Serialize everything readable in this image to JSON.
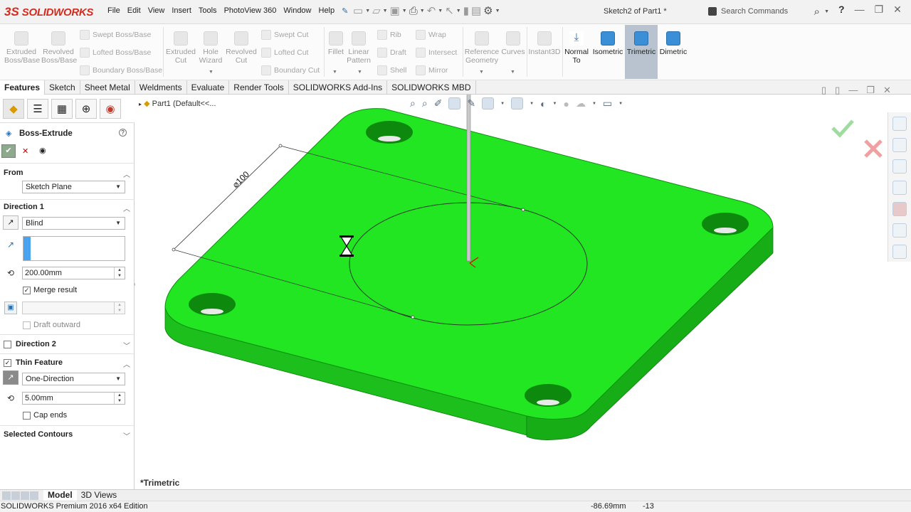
{
  "app": {
    "brand": "SOLIDWORKS",
    "document_title": "Sketch2 of Part1 *"
  },
  "menu": [
    "File",
    "Edit",
    "View",
    "Insert",
    "Tools",
    "PhotoView 360",
    "Window",
    "Help"
  ],
  "search": {
    "placeholder": "Search Commands"
  },
  "help_mark": "?",
  "commands": {
    "extruded_boss": "Extruded\nBoss/Base",
    "revolved_boss": "Revolved\nBoss/Base",
    "swept_boss": "Swept Boss/Base",
    "lofted_boss": "Lofted Boss/Base",
    "boundary_boss": "Boundary Boss/Base",
    "extruded_cut": "Extruded\nCut",
    "hole_wizard": "Hole\nWizard",
    "revolved_cut": "Revolved\nCut",
    "swept_cut": "Swept Cut",
    "lofted_cut": "Lofted Cut",
    "boundary_cut": "Boundary Cut",
    "fillet": "Fillet",
    "linear_pattern": "Linear\nPattern",
    "rib": "Rib",
    "draft": "Draft",
    "shell": "Shell",
    "wrap": "Wrap",
    "intersect": "Intersect",
    "mirror": "Mirror",
    "reference_geometry": "Reference\nGeometry",
    "curves": "Curves",
    "instant3d": "Instant3D",
    "normal_to": "Normal\nTo",
    "isometric": "Isometric",
    "trimetric": "Trimetric",
    "dimetric": "Dimetric"
  },
  "tabs": [
    "Features",
    "Sketch",
    "Sheet Metal",
    "Weldments",
    "Evaluate",
    "Render Tools",
    "SOLIDWORKS Add-Ins",
    "SOLIDWORKS MBD"
  ],
  "property_manager": {
    "title": "Boss-Extrude",
    "help": "?",
    "from_label": "From",
    "from_value": "Sketch Plane",
    "direction1_label": "Direction 1",
    "end_condition": "Blind",
    "depth": "200.00mm",
    "merge_result": "Merge result",
    "draft_outward": "Draft outward",
    "direction2_label": "Direction 2",
    "thin_feature_label": "Thin Feature",
    "thin_type": "One-Direction",
    "thickness": "5.00mm",
    "cap_ends": "Cap ends",
    "selected_contours": "Selected Contours"
  },
  "viewport": {
    "tree_item": "Part1  (Default<<...",
    "dimension_label": "⌀100",
    "view_name": "*Trimetric",
    "colors": {
      "part": "#1fe01f",
      "part_side": "#13a913",
      "hole": "#0c8a0c"
    }
  },
  "bottom_tabs": [
    "Model",
    "3D Views"
  ],
  "status": {
    "edition": "SOLIDWORKS Premium 2016 x64 Edition",
    "x": "-86.69mm",
    "y": "-13"
  }
}
